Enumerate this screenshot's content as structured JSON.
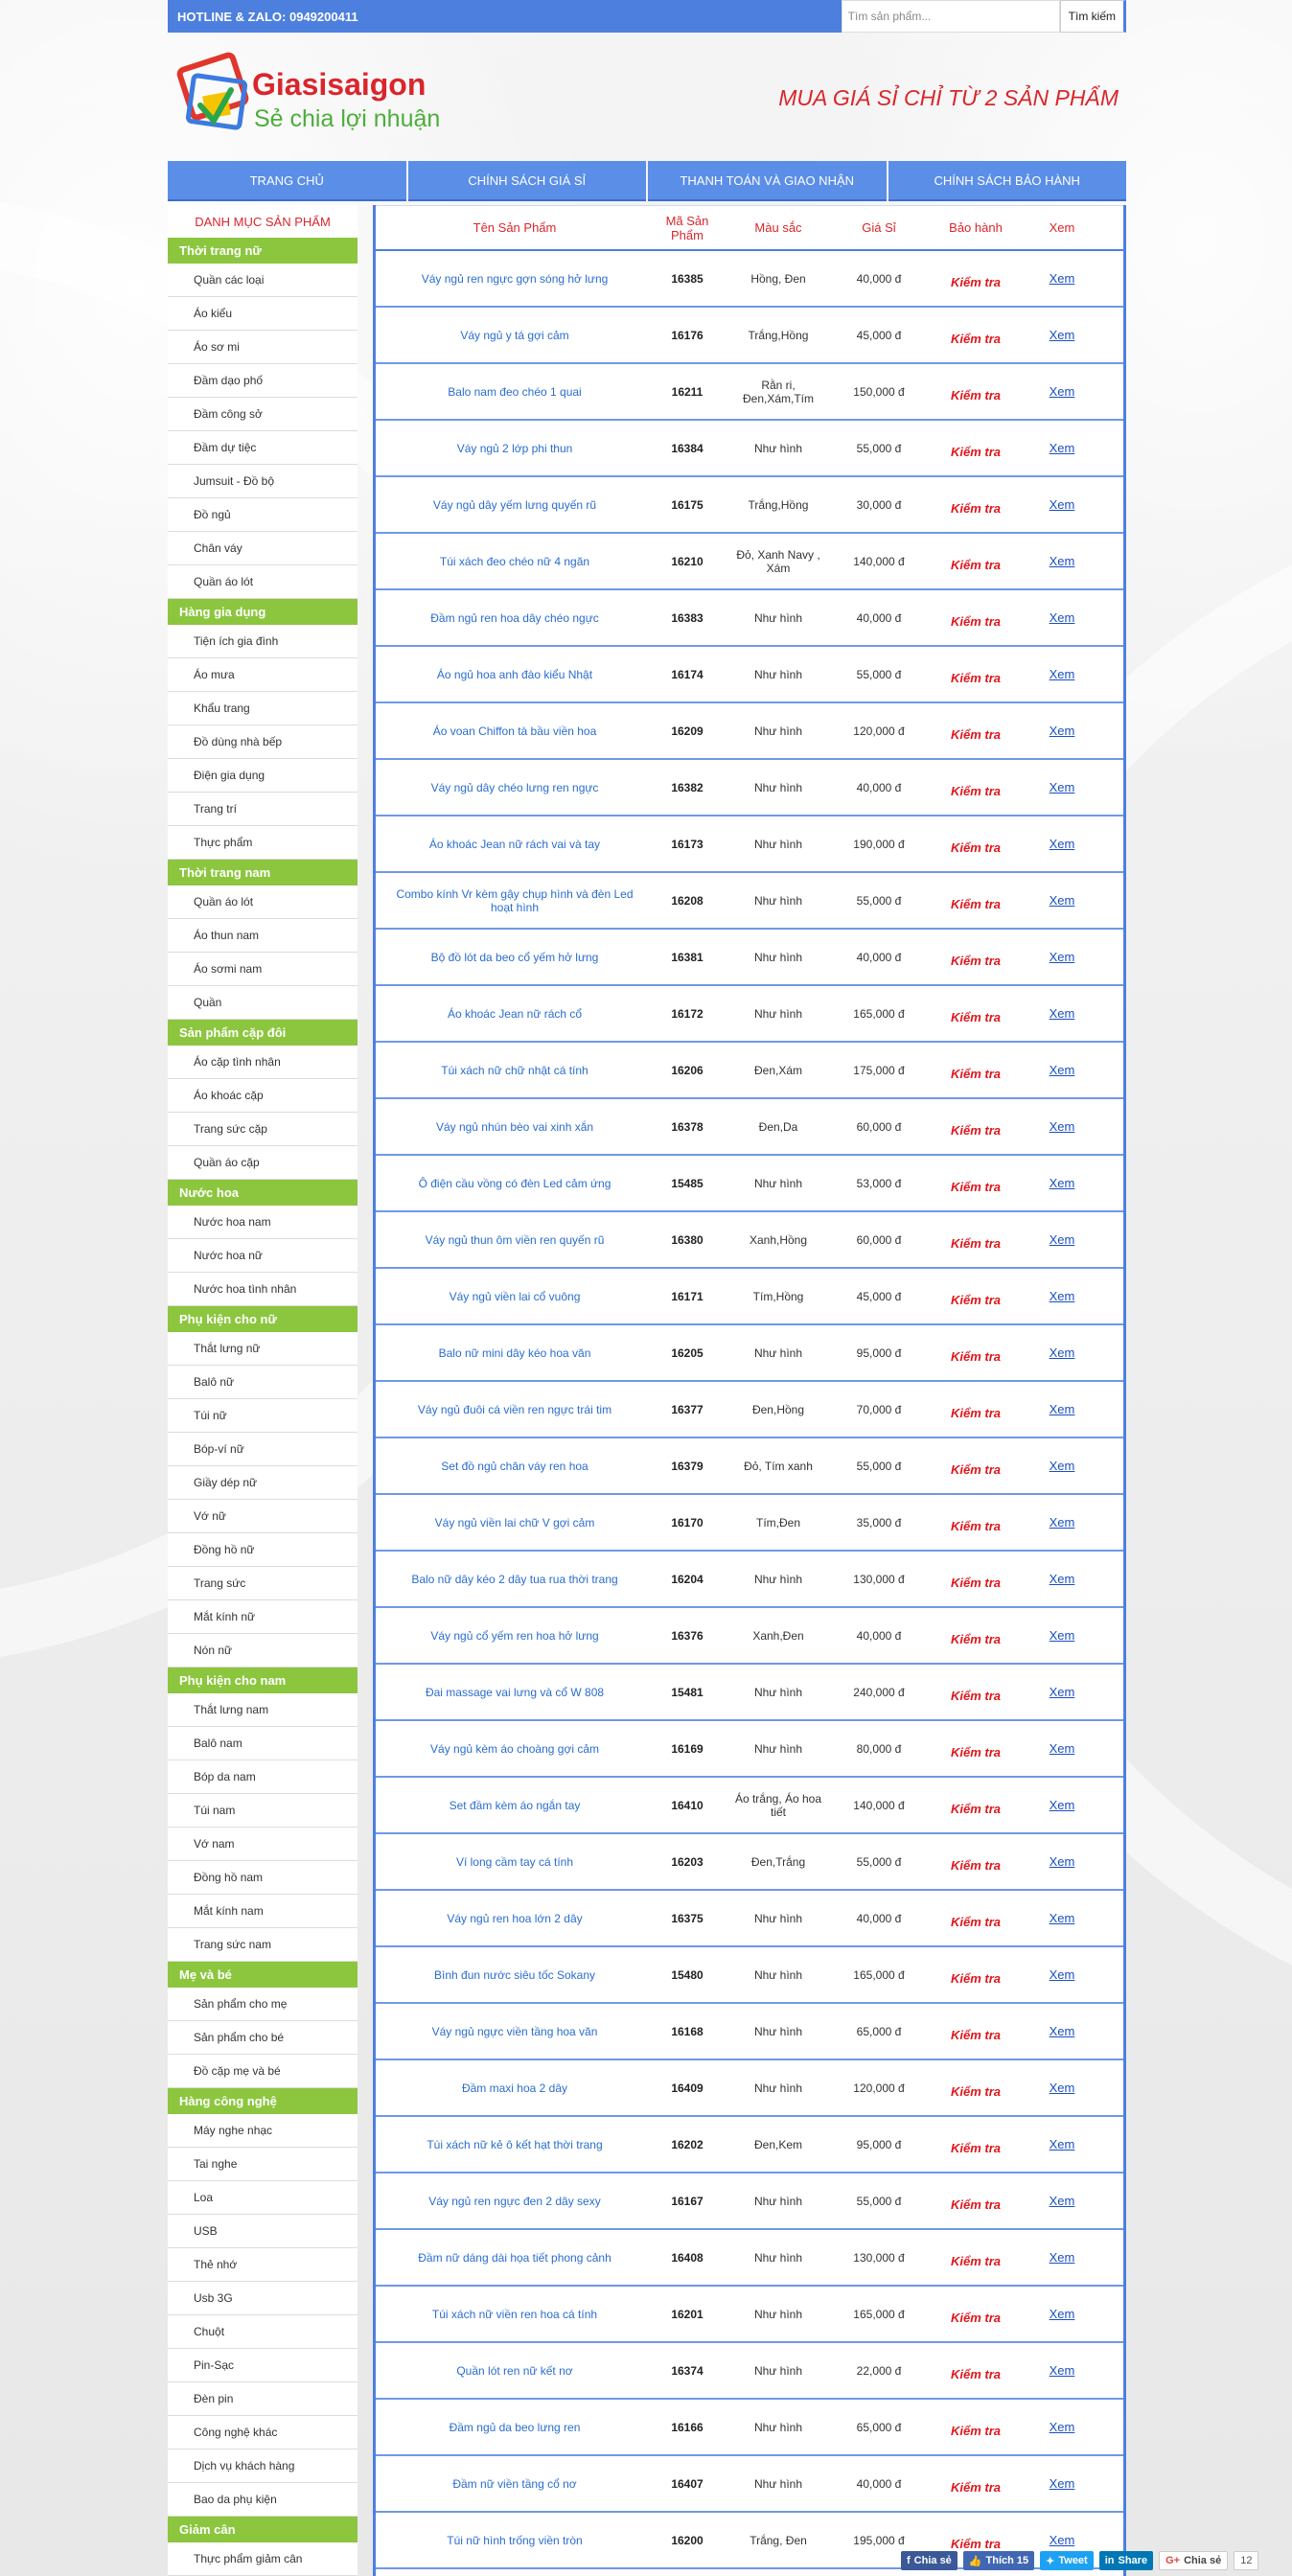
{
  "topbar": {
    "hotline": "HOTLINE & ZALO: 0949200411",
    "search_placeholder": "Tìm sản phẩm...",
    "search_button": "Tìm kiếm"
  },
  "header": {
    "logo_brand": "Giasisaigon",
    "logo_tagline": "Sẻ chia lợi nhuận",
    "slogan": "MUA GIÁ SỈ CHỈ TỪ 2 SẢN PHẨM"
  },
  "nav": [
    "TRANG CHỦ",
    "CHÍNH SÁCH GIÁ SỈ",
    "THANH TOÁN VÀ GIAO NHẬN",
    "CHÍNH SÁCH BẢO HÀNH"
  ],
  "sidebar": {
    "title": "DANH MỤC SẢN PHẨM",
    "categories": [
      {
        "name": "Thời trang nữ",
        "items": [
          "Quần các loại",
          "Áo kiểu",
          "Áo sơ mi",
          "Đầm dạo phố",
          "Đầm công sở",
          "Đầm dự tiệc",
          "Jumsuit - Đồ bộ",
          "Đồ ngủ",
          "Chân váy",
          "Quần áo lót"
        ]
      },
      {
        "name": "Hàng gia dụng",
        "items": [
          "Tiện ích gia đình",
          "Áo mưa",
          "Khẩu trang",
          "Đồ dùng nhà bếp",
          "Điện gia dụng",
          "Trang trí",
          "Thực phẩm"
        ]
      },
      {
        "name": "Thời trang nam",
        "items": [
          "Quần áo lót",
          "Áo thun nam",
          "Áo sơmi nam",
          "Quần"
        ]
      },
      {
        "name": "Sản phẩm cặp đôi",
        "items": [
          "Áo cặp tình nhân",
          "Áo khoác cặp",
          "Trang sức cặp",
          "Quần áo cặp"
        ]
      },
      {
        "name": "Nước hoa",
        "items": [
          "Nước hoa nam",
          "Nước hoa nữ",
          "Nước hoa tình nhân"
        ]
      },
      {
        "name": "Phụ kiện cho nữ",
        "items": [
          "Thắt lưng nữ",
          "Balô nữ",
          "Túi nữ",
          "Bóp-ví nữ",
          "Giầy dép nữ",
          "Vớ nữ",
          "Đồng hồ nữ",
          "Trang sức",
          "Mắt kính nữ",
          "Nón nữ"
        ]
      },
      {
        "name": "Phụ kiện cho nam",
        "items": [
          "Thắt lưng nam",
          "Balô nam",
          "Bóp da nam",
          "Túi nam",
          "Vớ nam",
          "Đồng hồ nam",
          "Mắt kính nam",
          "Trang sức nam"
        ]
      },
      {
        "name": "Mẹ và bé",
        "items": [
          "Sản phẩm cho mẹ",
          "Sản phẩm cho bé",
          "Đồ cặp mẹ và bé"
        ]
      },
      {
        "name": "Hàng công nghệ",
        "items": [
          "Máy nghe nhạc",
          "Tai nghe",
          "Loa",
          "USB",
          "Thẻ nhớ",
          "Usb 3G",
          "Chuột",
          "Pin-Sạc",
          "Đèn pin",
          "Công nghệ khác",
          "Dịch vụ khách hàng",
          "Bao da phụ kiện"
        ]
      },
      {
        "name": "Giảm cân",
        "items": [
          "Thực phẩm giảm cân"
        ]
      }
    ]
  },
  "table": {
    "headers": [
      "Tên Sản Phẩm",
      "Mã Sản Phẩm",
      "Màu sắc",
      "Giá Sỉ",
      "Bảo hành",
      "Xem"
    ],
    "check_label": "Kiểm tra",
    "view_label": "Xem",
    "rows": [
      {
        "name": "Váy ngủ ren ngực gợn sóng hở lưng",
        "code": "16385",
        "color": "Hồng, Đen",
        "price": "40,000 đ"
      },
      {
        "name": "Váy ngủ y tá gợi cảm",
        "code": "16176",
        "color": "Trắng,Hồng",
        "price": "45,000 đ"
      },
      {
        "name": "Balo nam đeo chéo 1 quai",
        "code": "16211",
        "color": "Rằn ri, Đen,Xám,Tím",
        "price": "150,000 đ"
      },
      {
        "name": "Váy ngủ 2 lớp phi thun",
        "code": "16384",
        "color": "Như hình",
        "price": "55,000 đ"
      },
      {
        "name": "Váy ngủ dây yếm lưng quyến rũ",
        "code": "16175",
        "color": "Trắng,Hồng",
        "price": "30,000 đ"
      },
      {
        "name": "Túi xách đeo chéo nữ 4 ngăn",
        "code": "16210",
        "color": "Đỏ, Xanh Navy , Xám",
        "price": "140,000 đ"
      },
      {
        "name": "Đầm ngủ ren hoa dây chéo ngực",
        "code": "16383",
        "color": "Như hình",
        "price": "40,000 đ"
      },
      {
        "name": "Áo ngủ hoa anh đào kiểu Nhật",
        "code": "16174",
        "color": "Như hình",
        "price": "55,000 đ"
      },
      {
        "name": "Áo voan Chiffon tà bầu viền hoa",
        "code": "16209",
        "color": "Như hình",
        "price": "120,000 đ"
      },
      {
        "name": "Váy ngủ dây chéo lưng ren ngực",
        "code": "16382",
        "color": "Như hình",
        "price": "40,000 đ"
      },
      {
        "name": "Áo khoác Jean nữ rách vai và tay",
        "code": "16173",
        "color": "Như hình",
        "price": "190,000 đ"
      },
      {
        "name": "Combo kính Vr kèm gậy chụp hình và đèn Led hoạt hình",
        "code": "16208",
        "color": "Như hình",
        "price": "55,000 đ"
      },
      {
        "name": "Bộ đồ lót da beo cổ yếm hở lưng",
        "code": "16381",
        "color": "Như hình",
        "price": "40,000 đ"
      },
      {
        "name": "Áo khoác Jean nữ rách cổ",
        "code": "16172",
        "color": "Như hình",
        "price": "165,000 đ"
      },
      {
        "name": "Túi xách nữ chữ nhật cá tính",
        "code": "16206",
        "color": "Đen,Xám",
        "price": "175,000 đ"
      },
      {
        "name": "Váy ngủ nhún bèo vai xinh xắn",
        "code": "16378",
        "color": "Đen,Da",
        "price": "60,000 đ"
      },
      {
        "name": "Ô điện cầu vồng có đèn Led cảm ứng",
        "code": "15485",
        "color": "Như hình",
        "price": "53,000 đ"
      },
      {
        "name": "Váy ngủ thun ôm viền ren quyến rũ",
        "code": "16380",
        "color": "Xanh,Hồng",
        "price": "60,000 đ"
      },
      {
        "name": "Váy ngủ viền lai cổ vuông",
        "code": "16171",
        "color": "Tím,Hồng",
        "price": "45,000 đ"
      },
      {
        "name": "Balo nữ mini dây kéo hoa văn",
        "code": "16205",
        "color": "Như hình",
        "price": "95,000 đ"
      },
      {
        "name": "Váy ngủ đuôi cá viền ren ngực trái tim",
        "code": "16377",
        "color": "Đen,Hồng",
        "price": "70,000 đ"
      },
      {
        "name": "Set đồ ngủ chân váy ren hoa",
        "code": "16379",
        "color": "Đỏ, Tím xanh",
        "price": "55,000 đ"
      },
      {
        "name": "Váy ngủ viền lai chữ V gợi cảm",
        "code": "16170",
        "color": "Tím,Đen",
        "price": "35,000 đ"
      },
      {
        "name": "Balo nữ dây kéo 2 dây tua rua thời trang",
        "code": "16204",
        "color": "Như hình",
        "price": "130,000 đ"
      },
      {
        "name": "Váy ngủ cổ yếm ren hoa hở lưng",
        "code": "16376",
        "color": "Xanh,Đen",
        "price": "40,000 đ"
      },
      {
        "name": "Đai massage vai lưng và cổ W 808",
        "code": "15481",
        "color": "Như hình",
        "price": "240,000 đ"
      },
      {
        "name": "Váy ngủ kèm áo choàng gợi cảm",
        "code": "16169",
        "color": "Như hình",
        "price": "80,000 đ"
      },
      {
        "name": "Set đầm kèm áo ngắn tay",
        "code": "16410",
        "color": "Áo trắng, Áo hoa tiết",
        "price": "140,000 đ"
      },
      {
        "name": "Ví long cầm tay cá tính",
        "code": "16203",
        "color": "Đen,Trắng",
        "price": "55,000 đ"
      },
      {
        "name": "Váy ngủ ren hoa lớn 2 dây",
        "code": "16375",
        "color": "Như hình",
        "price": "40,000 đ"
      },
      {
        "name": "Bình đun nước siêu tốc Sokany",
        "code": "15480",
        "color": "Như hình",
        "price": "165,000 đ"
      },
      {
        "name": "Váy ngủ ngực viền tầng hoa văn",
        "code": "16168",
        "color": "Như hình",
        "price": "65,000 đ"
      },
      {
        "name": "Đầm maxi hoa 2 dây",
        "code": "16409",
        "color": "Như hình",
        "price": "120,000 đ"
      },
      {
        "name": "Túi xách nữ kẻ ô kết hạt thời trang",
        "code": "16202",
        "color": "Đen,Kem",
        "price": "95,000 đ"
      },
      {
        "name": "Váy ngủ ren ngực đen 2 dây sexy",
        "code": "16167",
        "color": "Như hình",
        "price": "55,000 đ"
      },
      {
        "name": "Đầm nữ dáng dài họa tiết phong cảnh",
        "code": "16408",
        "color": "Như hình",
        "price": "130,000 đ"
      },
      {
        "name": "Túi xách nữ viền ren hoa cá tính",
        "code": "16201",
        "color": "Như hình",
        "price": "165,000 đ"
      },
      {
        "name": "Quần lót ren nữ kết nơ",
        "code": "16374",
        "color": "Như hình",
        "price": "22,000 đ"
      },
      {
        "name": "Đầm ngủ da beo lưng ren",
        "code": "16166",
        "color": "Như hình",
        "price": "65,000 đ"
      },
      {
        "name": "Đầm nữ viền tầng cổ nơ",
        "code": "16407",
        "color": "Như hình",
        "price": "40,000 đ"
      },
      {
        "name": "Túi nữ hình trống viền tròn",
        "code": "16200",
        "color": "Trắng, Đen",
        "price": "195,000 đ"
      }
    ]
  },
  "social": {
    "fb_share": "Chia sẻ",
    "fb_like": "Thích 15",
    "tweet": "Tweet",
    "linkedin": "Share",
    "gplus": "Chia sẻ",
    "count": "12"
  },
  "colors": {
    "primary_blue": "#4d7fde",
    "category_green": "#8cc63f",
    "accent_red": "#d9262c",
    "link_blue": "#2a6dcf"
  }
}
